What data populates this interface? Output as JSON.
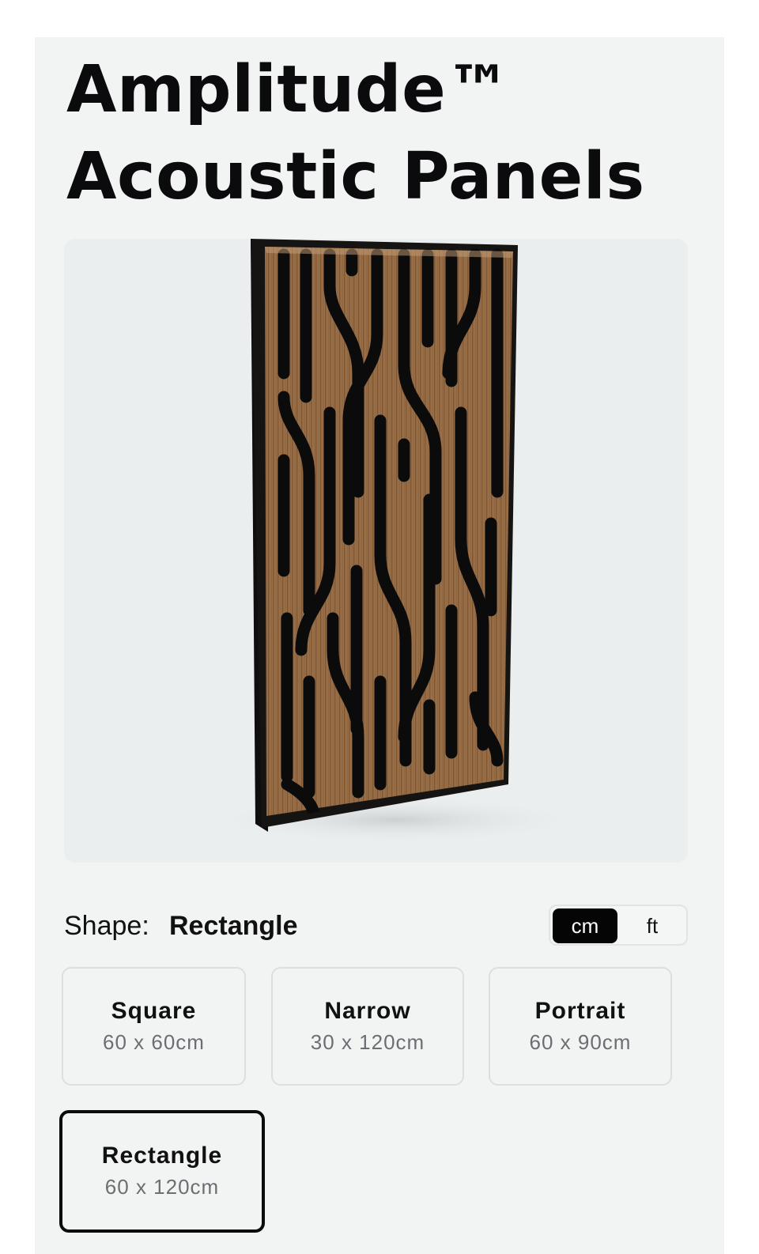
{
  "product": {
    "title_line1": "Amplitude™",
    "title_line2": "Acoustic Panels"
  },
  "image": {
    "alt": "Amplitude acoustic panel",
    "colors": {
      "wood": "#8a5f3a",
      "wood_light": "#a4784d",
      "frame": "#141212",
      "background": "#eaeeef"
    }
  },
  "shape": {
    "label": "Shape:",
    "selected": "Rectangle"
  },
  "units": {
    "active": "cm",
    "inactive": "ft"
  },
  "options": [
    {
      "name": "Square",
      "size": "60 x 60cm"
    },
    {
      "name": "Narrow",
      "size": "30 x 120cm"
    },
    {
      "name": "Portrait",
      "size": "60 x 90cm"
    },
    {
      "name": "Rectangle",
      "size": "60 x 120cm"
    }
  ],
  "accent_color": "#0b0b0d"
}
